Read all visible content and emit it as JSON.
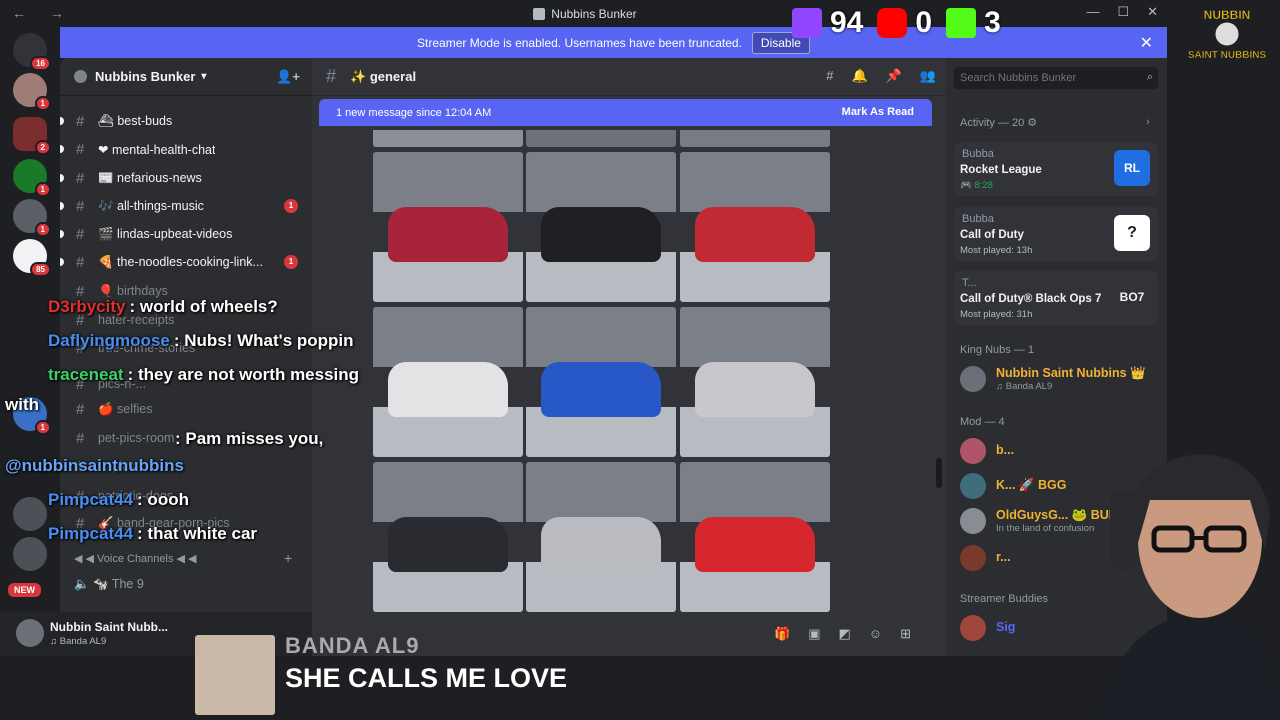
{
  "window": {
    "title": "Nubbins Bunker",
    "nav": "← →",
    "controls": [
      "—",
      "☐",
      "✕"
    ]
  },
  "rail": {
    "badges": [
      "16",
      "1",
      "2",
      "1",
      "1",
      "85",
      "1"
    ],
    "new_label": "NEW"
  },
  "banner": {
    "text": "Streamer Mode is enabled. Usernames have been truncated.",
    "disable_label": "Disable",
    "close": "✕"
  },
  "sidebar": {
    "guild_name": "Nubbins Bunker",
    "channels": [
      {
        "name": "⛴ best-buds",
        "unread": ""
      },
      {
        "name": "❤ mental-health-chat",
        "unread": ""
      },
      {
        "name": "📰 nefarious-news",
        "unread": ""
      },
      {
        "name": "🎶 all-things-music",
        "unread": "1"
      },
      {
        "name": "🎬 lindas-upbeat-videos",
        "unread": ""
      },
      {
        "name": "🍕 the-noodles-cooking-link...",
        "unread": "1"
      },
      {
        "name": "🎈 birthdays",
        "unread": ""
      },
      {
        "name": "hater-receipts",
        "unread": ""
      },
      {
        "name": "true-crime-stories",
        "unread": ""
      },
      {
        "name": "pics-n-...",
        "unread": ""
      },
      {
        "name": "🍎 selfies",
        "unread": ""
      },
      {
        "name": "pet-pics-room",
        "unread": ""
      },
      {
        "name": "...-pics",
        "unread": ""
      },
      {
        "name": "patriotic-dogs",
        "unread": ""
      },
      {
        "name": "🎸 band-gear-porn-pics",
        "unread": ""
      }
    ],
    "voice_category": "◀ ◀ Voice Channels ◀ ◀",
    "voice_channel": "🔈 🐄 The 9"
  },
  "user_panel": {
    "name": "Nubbin Saint Nubb...",
    "status": "♫ Banda AL9"
  },
  "chat": {
    "channel": "✨ general",
    "new_messages": "1 new message since 12:04 AM",
    "mark_read": "Mark As Read",
    "header_icons": [
      "#",
      "🔔",
      "📌",
      "👥"
    ]
  },
  "members": {
    "search_placeholder": "Search Nubbins Bunker",
    "activity_header": "Activity — 20 ⚙",
    "activities": [
      {
        "who": "Bubba",
        "game": "Rocket League",
        "meta": "🎮 8:28",
        "art": "RL"
      },
      {
        "who": "Bubba",
        "game": "Call of Duty",
        "meta": "Most played: 13h",
        "art": "?"
      },
      {
        "who": "T...",
        "game": "Call of Duty® Black Ops 7",
        "meta": "Most played: 31h",
        "art": "BO7"
      }
    ],
    "king_header": "King Nubs — 1",
    "king": {
      "name": "Nubbin Saint Nubbins 👑",
      "status": "♫ Banda AL9",
      "color": "#f0b232"
    },
    "mod_header": "Mod — 4",
    "mods": [
      {
        "name": "b...",
        "status": "",
        "color": "#f0b232"
      },
      {
        "name": "K... 🚀 BGG",
        "status": "",
        "color": "#f0b232"
      },
      {
        "name": "OldGuysG... 🐸 BUN",
        "status": "In the land of confusion",
        "color": "#f0b232"
      },
      {
        "name": "r...",
        "status": "",
        "color": "#f0b232"
      }
    ],
    "streamer_header": "Streamer Buddies",
    "streamer": {
      "name": "Sig",
      "color": "#5865f2"
    }
  },
  "overlay": {
    "chat": [
      {
        "user": "D3rbycity",
        "text": ": world of wheels?",
        "color": "#e23030"
      },
      {
        "user": "Daflyingmoose",
        "text": ": Nubs! What's poppin",
        "color": "#4a8df0"
      },
      {
        "user": "traceneat",
        "text": ": they are not worth messing",
        "color": "#3fd06a"
      },
      {
        "user": "",
        "text": "with",
        "color": "#ffffff"
      },
      {
        "user": "",
        "text": ": Pam misses you,",
        "color": "#ffffff"
      },
      {
        "user": "@nubbinsaintnubbins",
        "text": "",
        "color": "#6aa2f5"
      },
      {
        "user": "Pimpcat44",
        "text": ": oooh",
        "color": "#4a8df0"
      },
      {
        "user": "Pimpcat44",
        "text": ": that white car",
        "color": "#4a8df0"
      }
    ],
    "counters": [
      {
        "platform": "twitch",
        "value": "94",
        "color": "#9146ff"
      },
      {
        "platform": "youtube",
        "value": "0",
        "color": "#ff0000"
      },
      {
        "platform": "kick",
        "value": "3",
        "color": "#53fc18"
      }
    ],
    "logo": {
      "line1": "NUBBIN",
      "line2": "SAINT NUBBINS"
    },
    "now_playing": {
      "artist": "BANDA AL9",
      "track": "SHE CALLS ME LOVE"
    }
  },
  "colors": {
    "blurple": "#5865f2",
    "danger": "#da373c"
  }
}
